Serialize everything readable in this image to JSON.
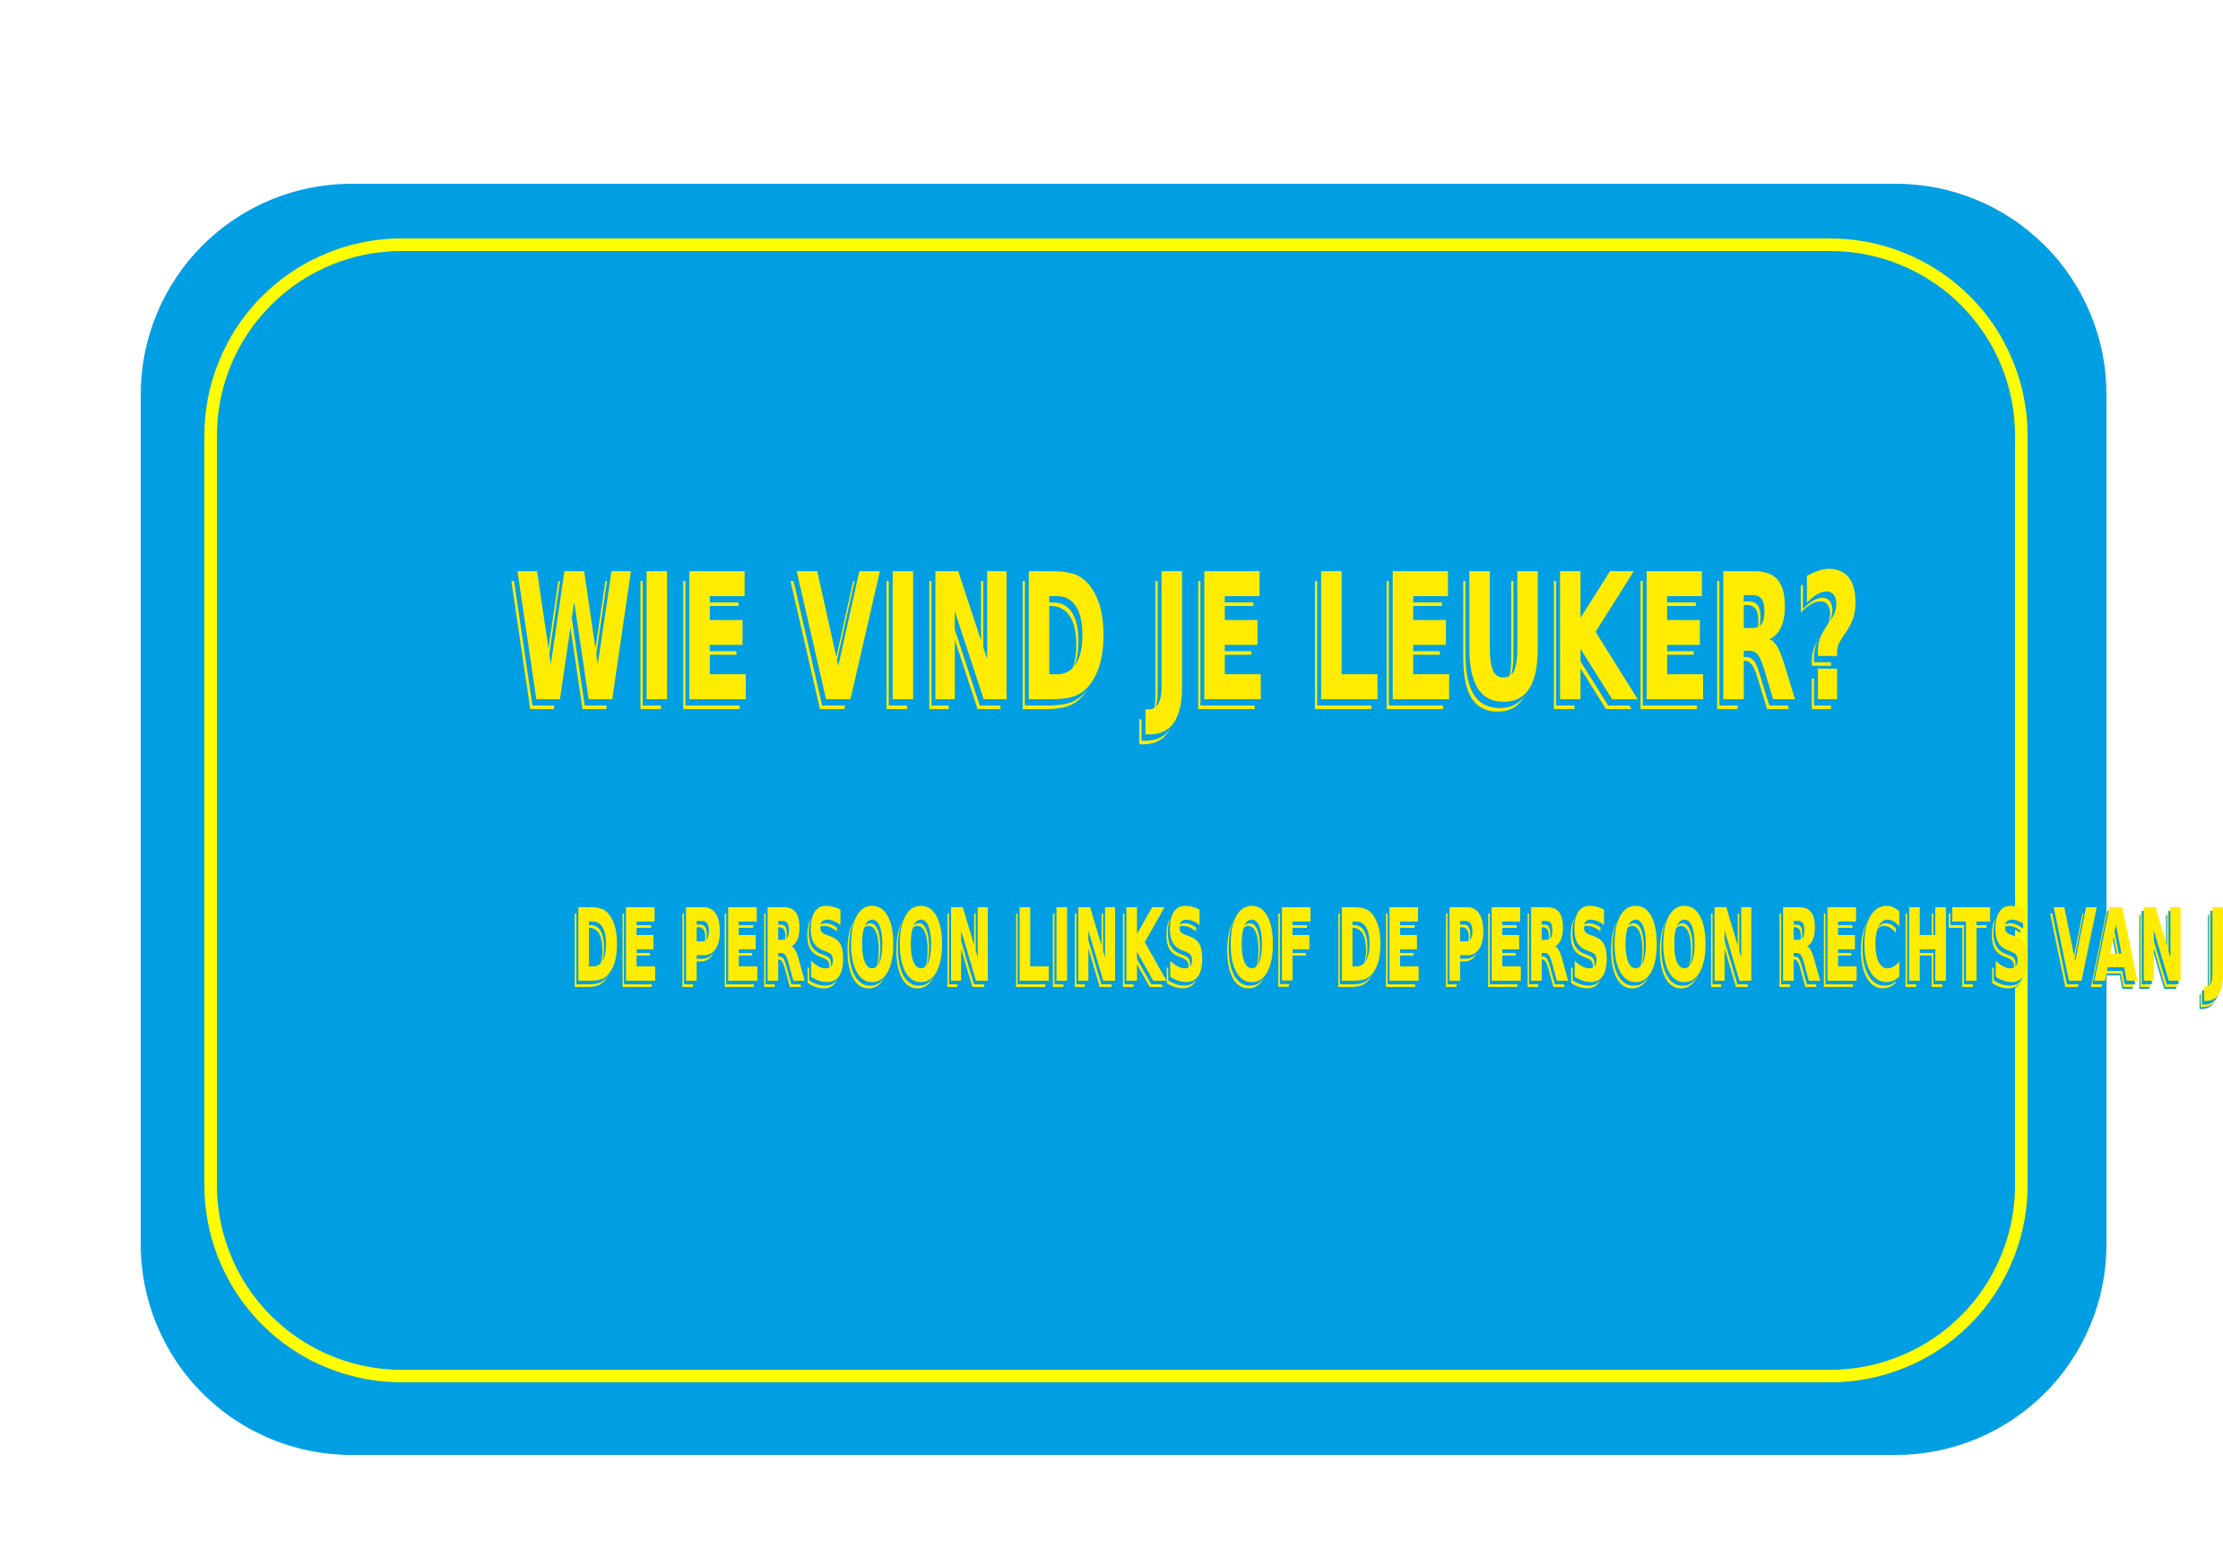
{
  "card": {
    "title": "WIE VIND JE LEUKER?",
    "subtitle": "DE PERSOON LINKS OF DE PERSOON RECHTS VAN JE?"
  },
  "colors": {
    "card_background": "#009fe3",
    "frame_border": "#ffff00",
    "text": "#ffec00",
    "page_background": "#ffffff"
  }
}
